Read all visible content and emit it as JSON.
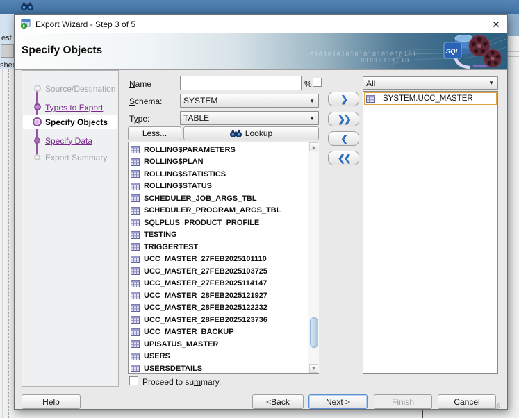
{
  "chrome": {
    "background_tab_fragment": "est",
    "background_panel_fragment": "shee"
  },
  "wizard": {
    "title": "Export Wizard - Step 3 of 5",
    "header_title": "Specify Objects",
    "binary_overlay_1": "010101010101010101010101",
    "binary_overlay_2": "01010101010",
    "logo_label": "SQL",
    "steps": [
      {
        "label": "Source/Destination",
        "state": "disabled"
      },
      {
        "label": "Types to Export",
        "state": "link"
      },
      {
        "label": "Specify Objects",
        "state": "current"
      },
      {
        "label": "Specify Data",
        "state": "link"
      },
      {
        "label": "Export Summary",
        "state": "disabled"
      }
    ],
    "form": {
      "name_label": "Name",
      "name_value": "",
      "percent_label": "%",
      "schema_label": "Schema:",
      "schema_value": "SYSTEM",
      "type_label": "Type:",
      "type_value": "TABLE",
      "less_button": "Less...",
      "lookup_button": "Lookup"
    },
    "available_objects": [
      "ROLLING$PARAMETERS",
      "ROLLING$PLAN",
      "ROLLING$STATISTICS",
      "ROLLING$STATUS",
      "SCHEDULER_JOB_ARGS_TBL",
      "SCHEDULER_PROGRAM_ARGS_TBL",
      "SQLPLUS_PRODUCT_PROFILE",
      "TESTING",
      "TRIGGERTEST",
      "UCC_MASTER_27FEB2025101110",
      "UCC_MASTER_27FEB2025103725",
      "UCC_MASTER_27FEB2025114147",
      "UCC_MASTER_28FEB2025121927",
      "UCC_MASTER_28FEB2025122232",
      "UCC_MASTER_28FEB2025123736",
      "UCC_MASTER_BACKUP",
      "UPISATUS_MASTER",
      "USERS",
      "USERSDETAILS"
    ],
    "target": {
      "filter_value": "All",
      "items": [
        "SYSTEM.UCC_MASTER"
      ]
    },
    "proceed_label": "Proceed to summary.",
    "buttons": {
      "help": "Help",
      "back": "< Back",
      "next": "Next >",
      "finish": "Finish",
      "cancel": "Cancel"
    },
    "icons": {
      "close": "✕",
      "dropdown": "▼",
      "shuttle_right": "❯",
      "shuttle_right_all": "❯❯",
      "shuttle_left": "❮",
      "shuttle_left_all": "❮❮",
      "scroll_up": "▲",
      "scroll_down": "▼"
    }
  }
}
